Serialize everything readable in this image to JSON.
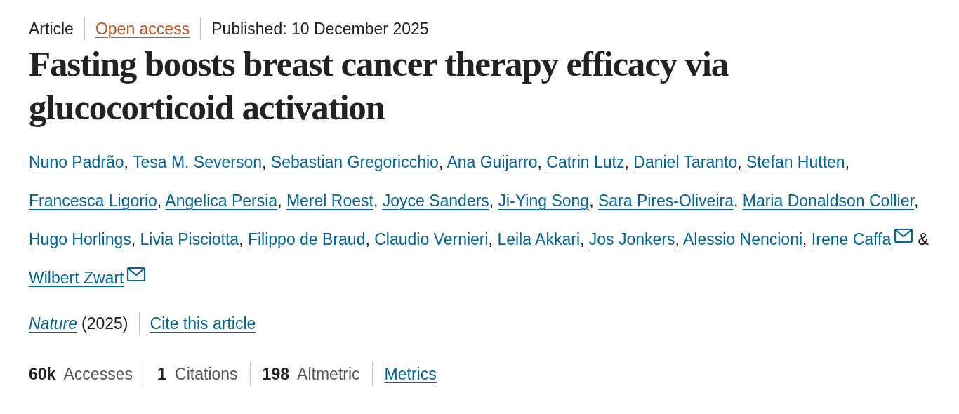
{
  "header": {
    "type": "Article",
    "access": "Open access",
    "published": "Published: 10 December 2025"
  },
  "title": "Fasting boosts breast cancer therapy efficacy via glucocorticoid activation",
  "authors": [
    {
      "name": "Nuno Padrão",
      "email": false,
      "after": ","
    },
    {
      "name": "Tesa M. Severson",
      "email": false,
      "after": ","
    },
    {
      "name": "Sebastian Gregoricchio",
      "email": false,
      "after": ","
    },
    {
      "name": "Ana Guijarro",
      "email": false,
      "after": ","
    },
    {
      "name": "Catrin Lutz",
      "email": false,
      "after": ","
    },
    {
      "name": "Daniel Taranto",
      "email": false,
      "after": ","
    },
    {
      "name": "Stefan Hutten",
      "email": false,
      "after": ","
    },
    {
      "name": "Francesca Ligorio",
      "email": false,
      "after": ","
    },
    {
      "name": "Angelica Persia",
      "email": false,
      "after": ","
    },
    {
      "name": "Merel Roest",
      "email": false,
      "after": ","
    },
    {
      "name": "Joyce Sanders",
      "email": false,
      "after": ","
    },
    {
      "name": "Ji-Ying Song",
      "email": false,
      "after": ","
    },
    {
      "name": "Sara Pires-Oliveira",
      "email": false,
      "after": ","
    },
    {
      "name": "Maria Donaldson Collier",
      "email": false,
      "after": ","
    },
    {
      "name": "Hugo Horlings",
      "email": false,
      "after": ","
    },
    {
      "name": "Livia Pisciotta",
      "email": false,
      "after": ","
    },
    {
      "name": "Filippo de Braud",
      "email": false,
      "after": ","
    },
    {
      "name": "Claudio Vernieri",
      "email": false,
      "after": ","
    },
    {
      "name": "Leila Akkari",
      "email": false,
      "after": ","
    },
    {
      "name": "Jos Jonkers",
      "email": false,
      "after": ","
    },
    {
      "name": "Alessio Nencioni",
      "email": false,
      "after": ","
    },
    {
      "name": "Irene Caffa",
      "email": true,
      "after": "&"
    },
    {
      "name": "Wilbert Zwart",
      "email": true
    }
  ],
  "journal": {
    "name": "Nature",
    "year": "(2025)",
    "cite": "Cite this article"
  },
  "metrics": [
    {
      "text": "**60k** Accesses"
    },
    {
      "text": "**1** Citations"
    },
    {
      "text": "**198** Altmetric"
    }
  ],
  "metrics_link": "Metrics"
}
